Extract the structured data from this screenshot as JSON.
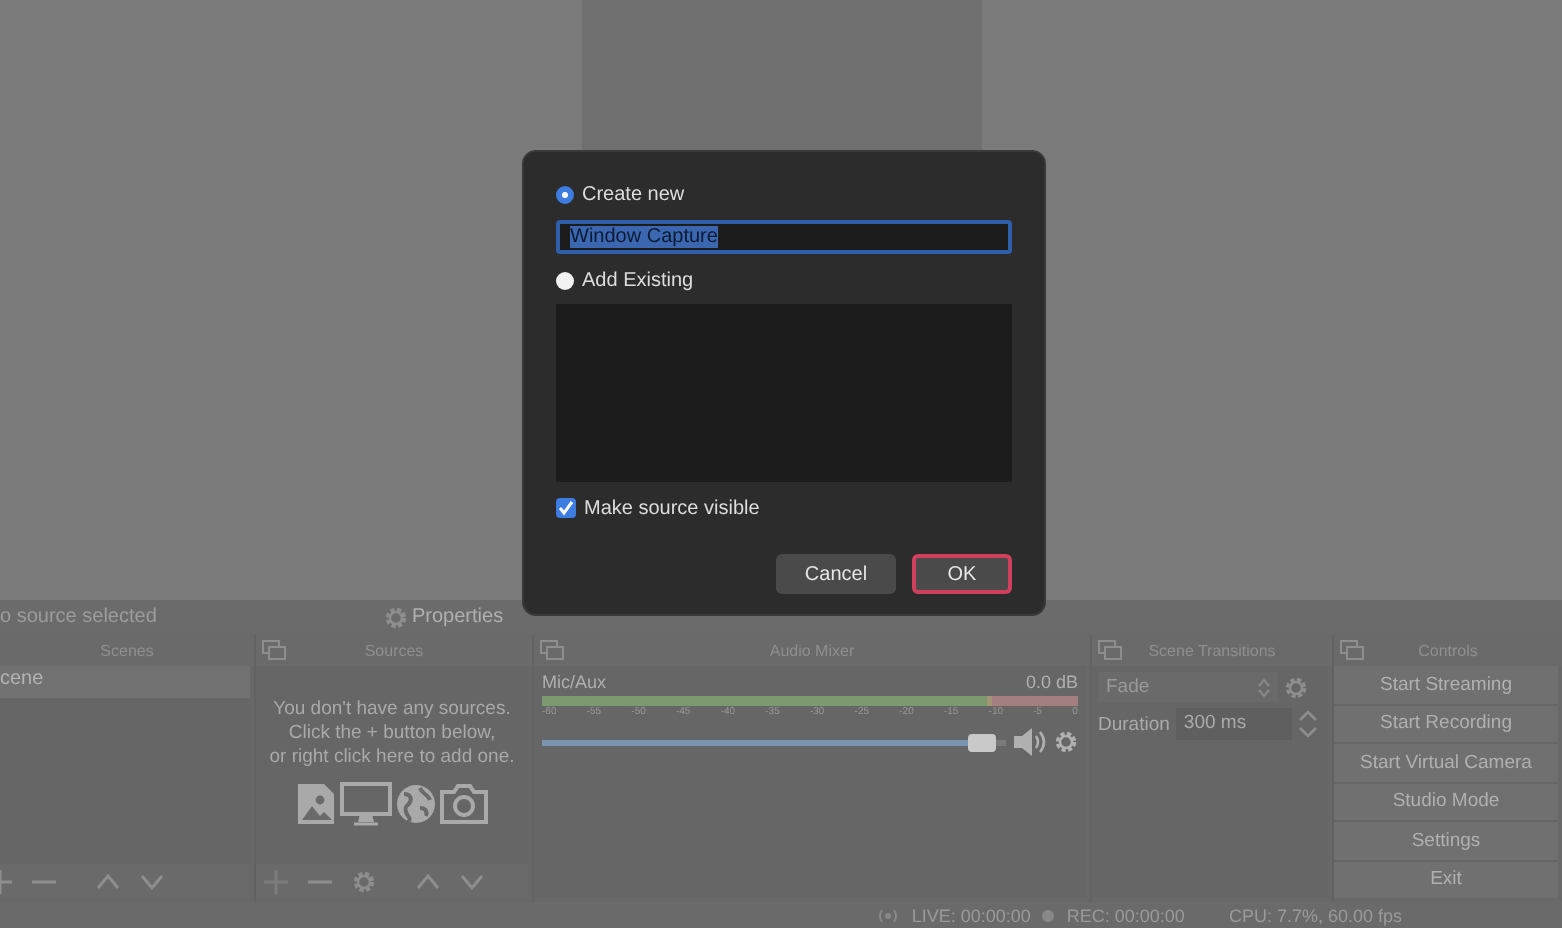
{
  "source_toolbar": {
    "label": "o source selected",
    "properties": "Properties"
  },
  "scenes": {
    "title": "Scenes",
    "items": [
      {
        "label": "cene",
        "selected": true
      }
    ]
  },
  "sources": {
    "title": "Sources",
    "empty_message": "You don't have any sources.\nClick the + button below,\nor right click here to add one."
  },
  "audio_mixer": {
    "title": "Audio Mixer",
    "channels": [
      {
        "name": "Mic/Aux",
        "reading": "0.0 dB",
        "ticks": [
          "-60",
          "-55",
          "-50",
          "-45",
          "-40",
          "-35",
          "-30",
          "-25",
          "-20",
          "-15",
          "-10",
          "-5",
          "0"
        ],
        "level": 0.95,
        "muted": false
      }
    ]
  },
  "scene_transitions": {
    "title": "Scene Transitions",
    "transition": "Fade",
    "duration_label": "Duration",
    "duration": "300 ms"
  },
  "controls": {
    "title": "Controls",
    "buttons": [
      "Start Streaming",
      "Start Recording",
      "Start Virtual Camera",
      "Studio Mode",
      "Settings",
      "Exit"
    ]
  },
  "status_bar": {
    "live": "LIVE: 00:00:00",
    "rec": "REC: 00:00:00",
    "cpu": "CPU: 7.7%, 60.00 fps"
  },
  "dialog": {
    "options": [
      {
        "label": "Create new",
        "selected": true
      },
      {
        "label": "Add Existing",
        "selected": false
      }
    ],
    "name_field": {
      "value": "Window Capture",
      "text_selected": true
    },
    "make_visible": {
      "label": "Make source visible",
      "checked": true
    },
    "buttons": [
      {
        "label": "Cancel",
        "focused": false
      },
      {
        "label": "OK",
        "focused": true
      }
    ]
  }
}
